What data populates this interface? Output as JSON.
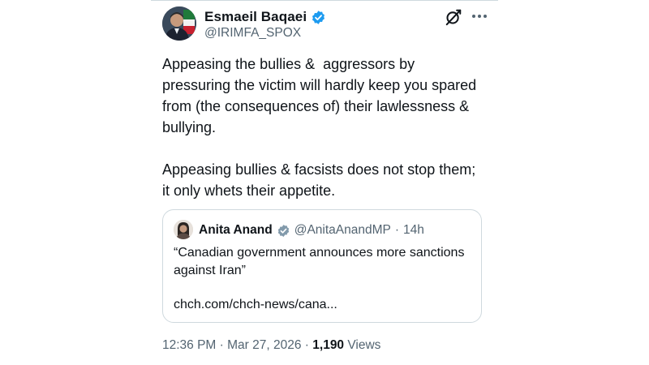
{
  "tweet": {
    "author": {
      "name": "Esmaeil Baqaei",
      "handle": "@IRIMFA_SPOX",
      "verified": true,
      "verified_color": "#1d9bf0"
    },
    "text": [
      "Appeasing the bullies &  aggressors by pressuring the victim will hardly keep you spared from (the consequences of) their lawlessness & bullying.",
      "Appeasing bullies & facsists does not stop them; it only whets their appetite."
    ],
    "quote": {
      "author_name": "Anita Anand",
      "verified": true,
      "verified_color": "#829aab",
      "handle": "@AnitaAnandMP",
      "separator": "·",
      "time": "14h",
      "text": "“Canadian government announces more sanctions against Iran”",
      "link": "chch.com/chch-news/cana..."
    },
    "meta": {
      "time": "12:36 PM",
      "separator": " · ",
      "date": "Mar 27, 2026",
      "views_count": "1,190",
      "views_label": " Views"
    }
  },
  "icons": {
    "grok": "grok-icon",
    "more": "more-icon",
    "verified": "verified-badge-icon"
  },
  "colors": {
    "text_primary": "#0f1419",
    "text_secondary": "#536471",
    "border": "#cfd9de"
  }
}
